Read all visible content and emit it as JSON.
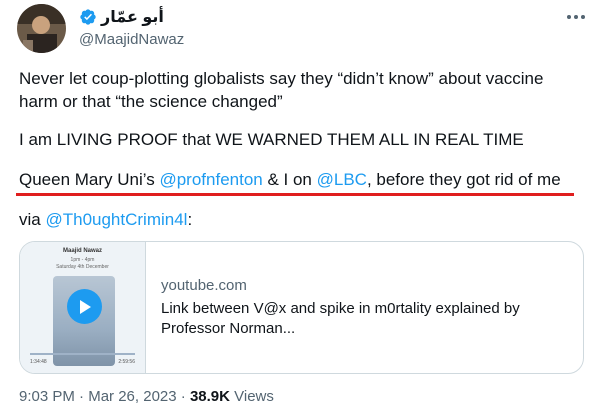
{
  "author": {
    "display_name": "أبو عمّار",
    "handle": "@MaajidNawaz",
    "verified_color": "#1d9bf0"
  },
  "tweet": {
    "paragraph1": "Never let coup-plotting globalists say they “didn’t know” about vaccine harm or that “the science changed”",
    "paragraph2": "I am LIVING PROOF that WE WARNED THEM ALL IN REAL TIME",
    "p3_part1": "Queen Mary Uni’s ",
    "p3_mention1": "@profnfenton",
    "p3_part2": " & I on ",
    "p3_mention2": "@LBC",
    "p3_part3": ", before they got rid of me",
    "p4_part1": "via ",
    "p4_mention": "@Th0ughtCrimin4l",
    "p4_part2": ":"
  },
  "card": {
    "domain": "youtube.com",
    "title": "Link between V@x and spike in m0rtality explained by Professor Norman...",
    "thumb_title": "Maajid Nawaz",
    "thumb_sub": "1pm - 4pm",
    "thumb_sub2": "Saturday 4th December",
    "thumb_time_start": "1:34:48",
    "thumb_time_end": "2:59:56"
  },
  "meta": {
    "time": "9:03 PM",
    "separator1": " · ",
    "date": "Mar 26, 2023",
    "separator2": " · ",
    "views_count": "38.9K",
    "views_label": " Views"
  },
  "colors": {
    "link": "#1d9bf0",
    "underline_annotation": "#e01e1e",
    "muted": "#536471"
  }
}
